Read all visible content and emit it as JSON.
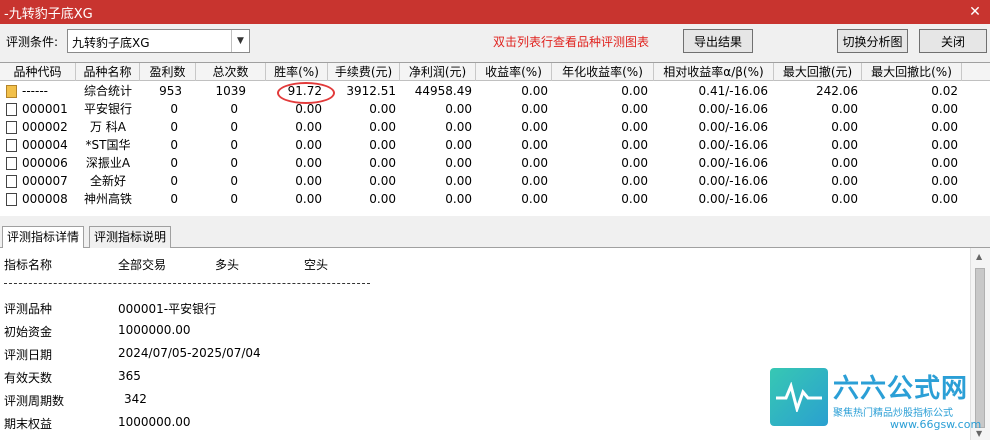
{
  "window": {
    "title": "-九转豹子底XG",
    "close_glyph": "✕"
  },
  "toolbar": {
    "condition_label": "评测条件:",
    "condition_value": "九转豹子底XG",
    "hint": "双击列表行查看品种评测图表",
    "export_label": "导出结果",
    "switch_label": "切换分析图",
    "close_label": "关闭"
  },
  "table": {
    "headers": [
      "品种代码",
      "品种名称",
      "盈利数",
      "总次数",
      "胜率(%)",
      "手续费(元)",
      "净利润(元)",
      "收益率(%)",
      "年化收益率(%)",
      "相对收益率α/β(%)",
      "最大回撤(元)",
      "最大回撤比(%)"
    ],
    "rows": [
      [
        "------",
        "综合统计",
        "953",
        "1039",
        "91.72",
        "3912.51",
        "44958.49",
        "0.00",
        "0.00",
        "0.41/-16.06",
        "242.06",
        "0.02"
      ],
      [
        "000001",
        "平安银行",
        "0",
        "0",
        "0.00",
        "0.00",
        "0.00",
        "0.00",
        "0.00",
        "0.00/-16.06",
        "0.00",
        "0.00"
      ],
      [
        "000002",
        "万 科A",
        "0",
        "0",
        "0.00",
        "0.00",
        "0.00",
        "0.00",
        "0.00",
        "0.00/-16.06",
        "0.00",
        "0.00"
      ],
      [
        "000004",
        "*ST国华",
        "0",
        "0",
        "0.00",
        "0.00",
        "0.00",
        "0.00",
        "0.00",
        "0.00/-16.06",
        "0.00",
        "0.00"
      ],
      [
        "000006",
        "深振业A",
        "0",
        "0",
        "0.00",
        "0.00",
        "0.00",
        "0.00",
        "0.00",
        "0.00/-16.06",
        "0.00",
        "0.00"
      ],
      [
        "000007",
        "全新好",
        "0",
        "0",
        "0.00",
        "0.00",
        "0.00",
        "0.00",
        "0.00",
        "0.00/-16.06",
        "0.00",
        "0.00"
      ],
      [
        "000008",
        "神州高铁",
        "0",
        "0",
        "0.00",
        "0.00",
        "0.00",
        "0.00",
        "0.00",
        "0.00/-16.06",
        "0.00",
        "0.00"
      ]
    ]
  },
  "tabs": [
    "评测指标详情",
    "评测指标说明"
  ],
  "detail": {
    "head": [
      "指标名称",
      "全部交易",
      "多头",
      "空头"
    ],
    "rows": [
      {
        "k": "评测品种",
        "v": "000001-平安银行"
      },
      {
        "k": "初始资金",
        "v": "1000000.00"
      },
      {
        "k": "评测日期",
        "v": "2024/07/05-2025/07/04"
      },
      {
        "k": "有效天数",
        "v": "365"
      },
      {
        "k": "评测周期数",
        "v": "342"
      },
      {
        "k": "期末权益",
        "v": "1000000.00"
      }
    ]
  },
  "brand": {
    "name": "六六公式网",
    "tag": "聚焦热门精品炒股指标公式",
    "url": "www.66gsw.com"
  },
  "colors": {
    "titlebar": "#c8342f",
    "hint": "#e0231f",
    "highlight": "#e23b3b",
    "brand": "#2b9fd6"
  }
}
